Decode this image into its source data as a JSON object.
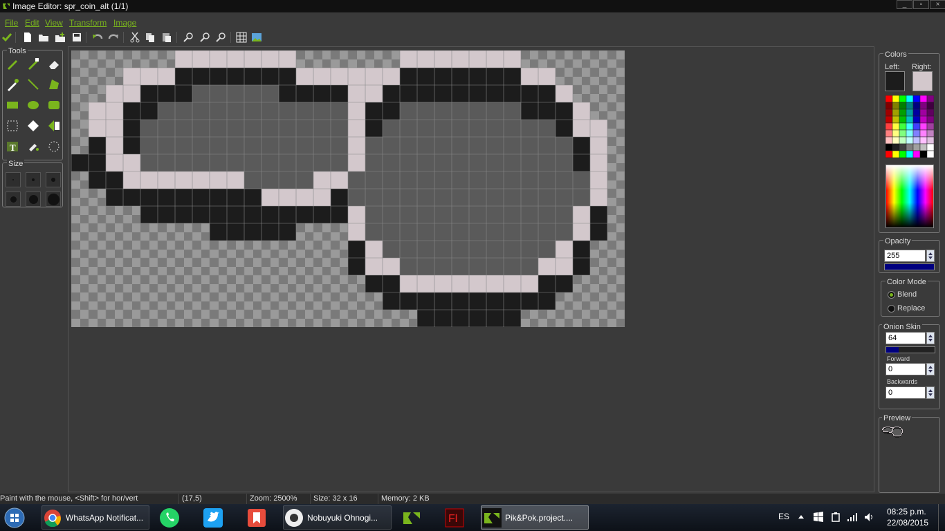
{
  "window": {
    "title": "Image Editor: spr_coin_alt (1/1)",
    "logo_icon": "gamemaker-icon"
  },
  "menu": [
    "File",
    "Edit",
    "View",
    "Transform",
    "Image"
  ],
  "toolbar": {
    "icons": [
      "confirm-check-icon",
      "new-image-icon",
      "open-icon",
      "add-icon",
      "save-icon",
      "undo-icon",
      "redo-icon",
      "cut-icon",
      "copy-icon",
      "paste-icon",
      "zoom-out-icon",
      "zoom-reset-icon",
      "zoom-in-icon",
      "grid-toggle-icon",
      "preview-image-icon"
    ]
  },
  "tools_panel": {
    "label": "Tools",
    "tools": [
      "pencil-icon",
      "spray-icon",
      "eraser-icon",
      "color-picker-icon",
      "line-icon",
      "polygon-icon",
      "rectangle-icon",
      "ellipse-icon",
      "rounded-rect-icon",
      "select-region-icon",
      "magic-wand-icon",
      "select-brush-icon",
      "text-icon",
      "fill-icon",
      "change-color-icon"
    ]
  },
  "size_panel": {
    "label": "Size",
    "sizes": [
      1,
      2,
      3,
      4,
      5,
      6
    ]
  },
  "colors": {
    "label": "Colors",
    "left_label": "Left:",
    "right_label": "Right:",
    "left_color": "#1c1c1c",
    "right_color": "#d3c8cc"
  },
  "opacity": {
    "label": "Opacity",
    "value": "255",
    "bar_fill": 1.0
  },
  "color_mode": {
    "label": "Color Mode",
    "blend": "Blend",
    "replace": "Replace",
    "selected": "Blend"
  },
  "onion_skin": {
    "label": "Onion Skin",
    "value": "64",
    "bar_fill": 0.25,
    "forward_label": "Forward",
    "forward_value": "0",
    "backwards_label": "Backwards",
    "backwards_value": "0"
  },
  "preview": {
    "label": "Preview"
  },
  "status": {
    "hint": "Paint with the mouse, <Shift> for hor/vert",
    "coords": "(17,5)",
    "zoom": "Zoom: 2500%",
    "size": "Size: 32 x 16",
    "memory": "Memory: 2 KB"
  },
  "sprite": {
    "width": 32,
    "height": 16,
    "palette": {
      "0": null,
      "1": "#1c1c1c",
      "2": "#d3c8cc",
      "3": "#5a5a5a"
    },
    "rows": [
      "00000022222220000000000000000000",
      "00022211111112222000000000000000",
      "00221113333311112200000000000000",
      "02211333333333331220000000000000",
      "02213333333333333122000000000000",
      "01213333333333333212000000000000",
      "11223333333333333221000000000000",
      "01122222223333222211000000000000",
      "00111111111222211111000000000000",
      "00001111111111111100000000000000",
      "00000000111110000000000000000000",
      "00000000000000000000000000000000",
      "00000000000000000000000000000000",
      "00000000000000000000000000000000",
      "00000000000000000000000000000000",
      "00000000000000000000000000000000"
    ],
    "rows_right": [
      "00000000000000000000000000000000",
      "00000000000000000000000000000000",
      "00000000000000000000000000000000",
      "00000000000000000000000000000000",
      "00000000000000000000000000000000",
      "00000000000000000000000000000000",
      "00000000000000000000000000000000",
      "00000000000000000000000000000000",
      "00000000000000000000000000000000",
      "00000000000000000000000000000000",
      "00000000000000000000000000000000",
      "00000000000000000000000000000000",
      "00000000000000000000000000000000",
      "00000000000000000000000000000000",
      "00000000000000000000000000000000",
      "00000000000000000000000000000000"
    ]
  },
  "taskbar": {
    "items": [
      {
        "label": "",
        "icon": "windows-start-icon"
      },
      {
        "label": "WhatsApp Notificat...",
        "icon": "chrome-icon"
      },
      {
        "label": "",
        "icon": "whatsapp-icon"
      },
      {
        "label": "",
        "icon": "twitter-icon"
      },
      {
        "label": "",
        "icon": "bookmark-app-icon"
      },
      {
        "label": "Nobuyuki Ohnogi...",
        "icon": "media-player-icon"
      },
      {
        "label": "",
        "icon": "gamemaker-icon"
      },
      {
        "label": "",
        "icon": "flash-icon"
      },
      {
        "label": "Pik&Pok.project....",
        "icon": "gamemaker-icon"
      }
    ],
    "lang": "ES",
    "time": "08:25 p.m.",
    "date": "22/08/2015"
  }
}
